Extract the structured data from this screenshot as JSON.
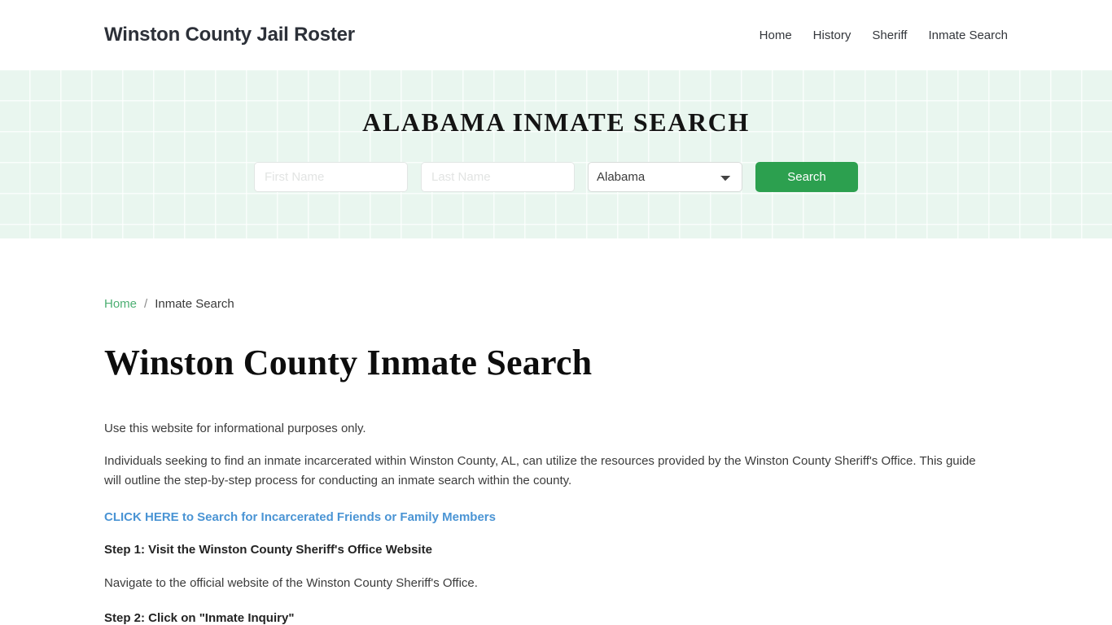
{
  "header": {
    "site_title": "Winston County Jail Roster",
    "nav": [
      {
        "label": "Home"
      },
      {
        "label": "History"
      },
      {
        "label": "Sheriff"
      },
      {
        "label": "Inmate Search"
      }
    ]
  },
  "hero": {
    "title": "ALABAMA INMATE SEARCH",
    "first_name_placeholder": "First Name",
    "first_name_value": "",
    "last_name_placeholder": "Last Name",
    "last_name_value": "",
    "state_selected": "Alabama",
    "search_button_label": "Search"
  },
  "breadcrumb": {
    "home_label": "Home",
    "separator": "/",
    "current_label": "Inmate Search"
  },
  "main": {
    "page_title": "Winston County Inmate Search",
    "intro": "Use this website for informational purposes only.",
    "detail": "Individuals seeking to find an inmate incarcerated within Winston County, AL, can utilize the resources provided by the Winston County Sheriff's Office. This guide will outline the step-by-step process for conducting an inmate search within the county.",
    "cta_link": "CLICK HERE to Search for Incarcerated Friends or Family Members",
    "step1_heading": "Step 1: Visit the Winston County Sheriff's Office Website",
    "step1_text": "Navigate to the official website of the Winston County Sheriff's Office.",
    "step2_heading": "Step 2: Click on \"Inmate Inquiry\""
  },
  "colors": {
    "hero_background": "#e9f6ef",
    "accent_green": "#2ca04f",
    "breadcrumb_green": "#4caf72",
    "link_blue": "#4a94d4",
    "title_dark": "#2c3038"
  }
}
